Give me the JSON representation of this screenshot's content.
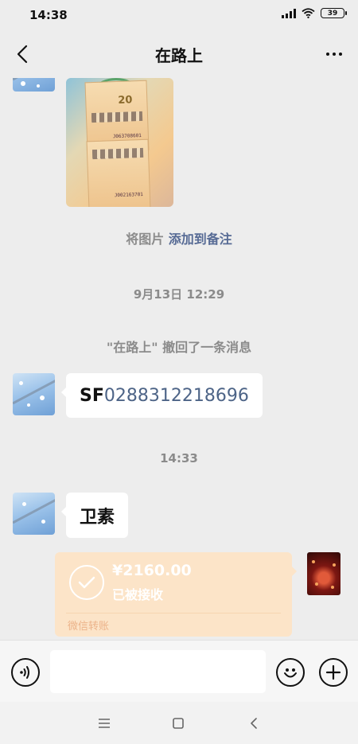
{
  "status_bar": {
    "time": "14:38",
    "battery": "39"
  },
  "header": {
    "title": "在路上"
  },
  "messages": {
    "image_note": {
      "prefix": "将图片 ",
      "link": "添加到备注"
    },
    "timestamp_1": "9月13日 12:29",
    "recall_notice": "\"在路上\" 撤回了一条消息",
    "tracking": {
      "prefix": "SF",
      "number": "0288312218696"
    },
    "timestamp_2": "14:33",
    "text_2": "卫素",
    "transfer": {
      "amount": "¥2160.00",
      "status": "已被接收",
      "label": "微信转账"
    }
  },
  "colors": {
    "link": "#576b95",
    "transfer_bg": "#fce4c8",
    "background": "#ededed"
  }
}
